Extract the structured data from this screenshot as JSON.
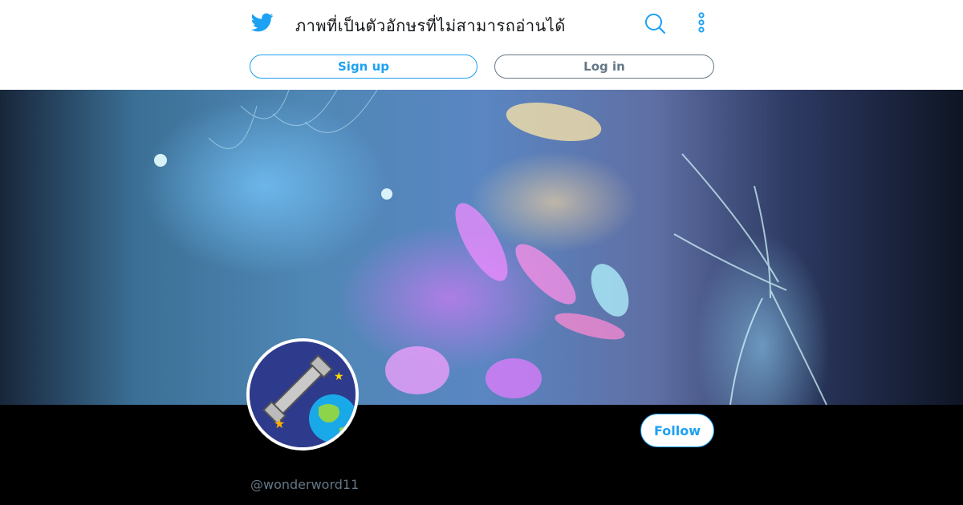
{
  "header": {
    "logo_icon": "twitter-bird-icon",
    "title": "ภาพที่เป็นตัวอักษรที่ไม่สามารถอ่านได้",
    "search_icon": "search-icon",
    "more_icon": "more-vertical-icon",
    "signup_label": "Sign up",
    "login_label": "Log in"
  },
  "profile": {
    "follow_label": "Follow",
    "handle": "@wonderword11"
  },
  "colors": {
    "brand": "#1da1f2",
    "muted": "#657786"
  }
}
